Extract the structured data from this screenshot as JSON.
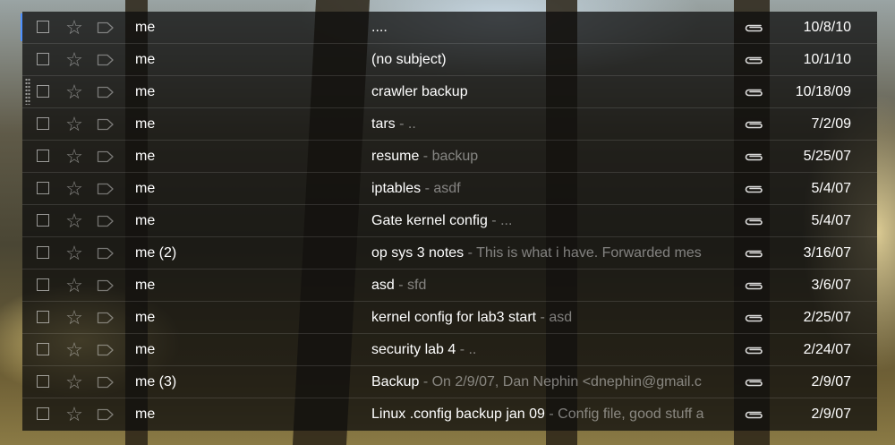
{
  "inbox": {
    "rows": [
      {
        "sender": "me",
        "subject": "....",
        "snippet": "",
        "date": "10/8/10"
      },
      {
        "sender": "me",
        "subject": "(no subject)",
        "snippet": "",
        "date": "10/1/10"
      },
      {
        "sender": "me",
        "subject": "crawler backup",
        "snippet": "",
        "date": "10/18/09"
      },
      {
        "sender": "me",
        "subject": "tars",
        "snippet": " - ..",
        "date": "7/2/09"
      },
      {
        "sender": "me",
        "subject": "resume",
        "snippet": " - backup",
        "date": "5/25/07"
      },
      {
        "sender": "me",
        "subject": "iptables",
        "snippet": " - asdf",
        "date": "5/4/07"
      },
      {
        "sender": "me",
        "subject": "Gate kernel config",
        "snippet": " - ...",
        "date": "5/4/07"
      },
      {
        "sender": "me (2)",
        "subject": "op sys 3 notes",
        "snippet": " - This is what i have. Forwarded mes",
        "date": "3/16/07"
      },
      {
        "sender": "me",
        "subject": "asd",
        "snippet": " - sfd",
        "date": "3/6/07"
      },
      {
        "sender": "me",
        "subject": "kernel config for lab3 start",
        "snippet": " - asd",
        "date": "2/25/07"
      },
      {
        "sender": "me",
        "subject": "security lab 4",
        "snippet": " - ..",
        "date": "2/24/07"
      },
      {
        "sender": "me (3)",
        "subject": "Backup",
        "snippet": " - On 2/9/07, Dan Nephin <dnephin@gmail.c",
        "date": "2/9/07"
      },
      {
        "sender": "me",
        "subject": "Linux .config backup jan 09",
        "snippet": " - Config file, good stuff a",
        "date": "2/9/07"
      }
    ],
    "icons": {
      "checkbox": "checkbox-icon",
      "star": "star-icon",
      "label": "label-tag-icon",
      "attachment": "paperclip-icon"
    },
    "colors": {
      "text": "#ffffff",
      "snippet": "#8a8a8a",
      "focus": "#4d90fe"
    }
  }
}
